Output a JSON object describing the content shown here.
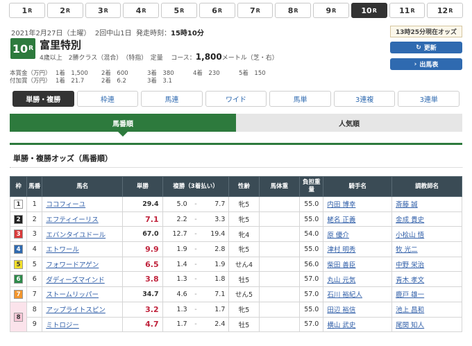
{
  "race_nav": [
    {
      "num": "1",
      "suffix": "R",
      "active": false
    },
    {
      "num": "2",
      "suffix": "R",
      "active": false
    },
    {
      "num": "3",
      "suffix": "R",
      "active": false
    },
    {
      "num": "4",
      "suffix": "R",
      "active": false
    },
    {
      "num": "5",
      "suffix": "R",
      "active": false
    },
    {
      "num": "6",
      "suffix": "R",
      "active": false
    },
    {
      "num": "7",
      "suffix": "R",
      "active": false
    },
    {
      "num": "8",
      "suffix": "R",
      "active": false
    },
    {
      "num": "9",
      "suffix": "R",
      "active": false
    },
    {
      "num": "10",
      "suffix": "R",
      "active": true
    },
    {
      "num": "11",
      "suffix": "R",
      "active": false
    },
    {
      "num": "12",
      "suffix": "R",
      "active": false
    }
  ],
  "meta": {
    "date": "2021年2月27日（土曜）",
    "meeting": "2回中山1日",
    "start_label": "発走時刻：",
    "start_time": "15時10分"
  },
  "odds_time": "13時25分現在オッズ",
  "buttons": {
    "update": "更新",
    "entry": "出馬表"
  },
  "race": {
    "num": "10",
    "suffix": "R",
    "name": "富里特別",
    "cond": "4歳以上　2勝クラス（混合）　（特指）　定量",
    "course_label": "コース：",
    "distance": "1,800",
    "course_unit": "メートル（芝・右）"
  },
  "prize": {
    "row1_label": "本賞金（万円）",
    "row1": [
      "1着　1,500",
      "2着　600",
      "3着　380",
      "4着　230",
      "5着　150"
    ],
    "row2_label": "付加賞（万円）",
    "row2": [
      "1着　21.7",
      "2着　6.2",
      "3着　3.1"
    ]
  },
  "bet_tabs": [
    "単勝・複勝",
    "枠連",
    "馬連",
    "ワイド",
    "馬単",
    "3連複",
    "3連単"
  ],
  "sort_tabs": [
    "馬番順",
    "人気順"
  ],
  "section_title": "単勝・複勝オッズ（馬番順）",
  "table": {
    "headers": [
      "枠",
      "馬番",
      "馬名",
      "単勝",
      "複勝（3着払い）",
      "性齢",
      "馬体重",
      "負担重量",
      "騎手名",
      "調教師名"
    ],
    "rows": [
      {
        "waku": "1",
        "waku_bg": "#ffffff",
        "waku_fg": "#333333",
        "ban": "1",
        "name": "ココフィーユ",
        "win": "29.4",
        "hot": false,
        "pl_lo": "5.0",
        "pl_hi": "7.7",
        "sex": "牝5",
        "weight": "",
        "burden": "55.0",
        "jockey": "内田 博幸",
        "trainer": "斎藤 誠"
      },
      {
        "waku": "2",
        "waku_bg": "#222222",
        "waku_fg": "#ffffff",
        "ban": "2",
        "name": "エフティイーリス",
        "win": "7.1",
        "hot": true,
        "pl_lo": "2.2",
        "pl_hi": "3.3",
        "sex": "牝5",
        "weight": "",
        "burden": "55.0",
        "jockey": "蛯名 正義",
        "trainer": "金成 貴史"
      },
      {
        "waku": "3",
        "waku_bg": "#d93a3a",
        "waku_fg": "#ffffff",
        "ban": "3",
        "name": "エバンタイユドール",
        "win": "67.0",
        "hot": false,
        "pl_lo": "12.7",
        "pl_hi": "19.4",
        "sex": "牝4",
        "weight": "",
        "burden": "54.0",
        "jockey": "原 優介",
        "trainer": "小桧山 悟"
      },
      {
        "waku": "4",
        "waku_bg": "#2f6ab0",
        "waku_fg": "#ffffff",
        "ban": "4",
        "name": "エトワール",
        "win": "9.9",
        "hot": true,
        "pl_lo": "1.9",
        "pl_hi": "2.8",
        "sex": "牝5",
        "weight": "",
        "burden": "55.0",
        "jockey": "津村 明秀",
        "trainer": "牧 光二"
      },
      {
        "waku": "5",
        "waku_bg": "#f3e02c",
        "waku_fg": "#333333",
        "ban": "5",
        "name": "フォワードアゲン",
        "win": "6.5",
        "hot": true,
        "pl_lo": "1.4",
        "pl_hi": "1.9",
        "sex": "せん4",
        "weight": "",
        "burden": "56.0",
        "jockey": "柴田 善臣",
        "trainer": "中野 栄治"
      },
      {
        "waku": "6",
        "waku_bg": "#2d8a4a",
        "waku_fg": "#ffffff",
        "ban": "6",
        "name": "ダディーズマインド",
        "win": "3.8",
        "hot": true,
        "pl_lo": "1.3",
        "pl_hi": "1.8",
        "sex": "牡5",
        "weight": "",
        "burden": "57.0",
        "jockey": "丸山 元気",
        "trainer": "青木 孝文"
      },
      {
        "waku": "7",
        "waku_bg": "#f2962e",
        "waku_fg": "#ffffff",
        "ban": "7",
        "name": "ストームリッパー",
        "win": "34.7",
        "hot": false,
        "pl_lo": "4.6",
        "pl_hi": "7.1",
        "sex": "せん5",
        "weight": "",
        "burden": "57.0",
        "jockey": "石川 裕紀人",
        "trainer": "鹿戸 雄一"
      },
      {
        "waku": "8",
        "waku_bg": "#f6c6d6",
        "waku_fg": "#333333",
        "ban": "8",
        "name": "アップライトスピン",
        "win": "3.2",
        "hot": true,
        "pl_lo": "1.3",
        "pl_hi": "1.7",
        "sex": "牝5",
        "weight": "",
        "burden": "55.0",
        "jockey": "田辺 裕信",
        "trainer": "池上 昌和"
      },
      {
        "waku": "",
        "waku_bg": "#f6c6d6",
        "waku_fg": "#333333",
        "ban": "9",
        "name": "ミトロジー",
        "win": "4.7",
        "hot": true,
        "pl_lo": "1.7",
        "pl_hi": "2.4",
        "sex": "牡5",
        "weight": "",
        "burden": "57.0",
        "jockey": "横山 武史",
        "trainer": "尾関 知人"
      }
    ]
  }
}
